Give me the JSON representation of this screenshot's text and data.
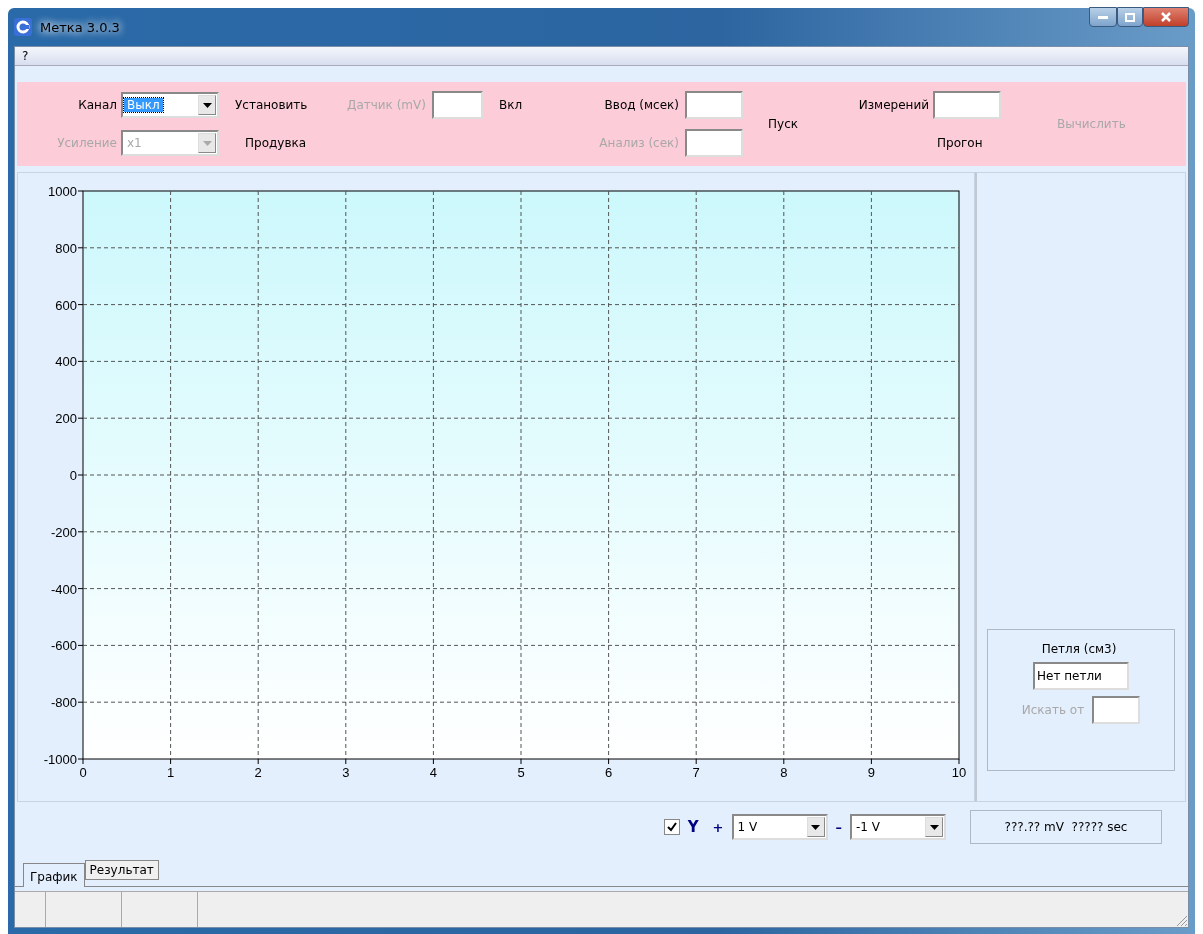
{
  "window": {
    "title": "Метка 3.0.3"
  },
  "menu": [
    {
      "label": "?"
    }
  ],
  "toolbar": {
    "channel": {
      "label": "Канал",
      "value": "Выкл",
      "disabled": false,
      "focused": true
    },
    "gain": {
      "label": "Усиление",
      "value": "x1",
      "disabled": true,
      "focused": false
    },
    "set_button": {
      "label": "Установить",
      "disabled": false
    },
    "purge_button": {
      "label": "Продувка",
      "disabled": false
    },
    "sensor": {
      "label": "Датчик (mV)",
      "disabled": true
    },
    "on_button": {
      "label": "Вкл",
      "disabled": false
    },
    "input": {
      "label": "Ввод (мсек)",
      "disabled": false
    },
    "analysis": {
      "label": "Анализ (сек)",
      "disabled": true
    },
    "start_button": {
      "label": "Пуск",
      "disabled": false
    },
    "measurements": {
      "label": "Измерений",
      "disabled": false
    },
    "run_button": {
      "label": "Прогон",
      "disabled": false
    },
    "compute_button": {
      "label": "Вычислить",
      "disabled": true
    }
  },
  "chart_data": {
    "type": "line",
    "grid": true,
    "xlim": [
      0,
      10
    ],
    "ylim": [
      -1000,
      1000
    ],
    "xticks": [
      0,
      1,
      2,
      3,
      4,
      5,
      6,
      7,
      8,
      9,
      10
    ],
    "yticks": [
      -1000,
      -800,
      -600,
      -400,
      -200,
      0,
      200,
      400,
      600,
      800,
      1000
    ]
  },
  "loop_panel": {
    "title": "Петля (см3)",
    "value": "Нет петли",
    "search_label": "Искать от",
    "search_disabled": true
  },
  "controls": {
    "y_checkbox": {
      "label": "Y",
      "checked": true
    },
    "plus": "+",
    "plus_value": "1 V",
    "minus": "–",
    "minus_value": "-1 V",
    "readout": "???.?? mV  ????? sec"
  },
  "tabs": [
    {
      "label": "График",
      "selected": true
    },
    {
      "label": "Результат",
      "selected": false
    }
  ]
}
